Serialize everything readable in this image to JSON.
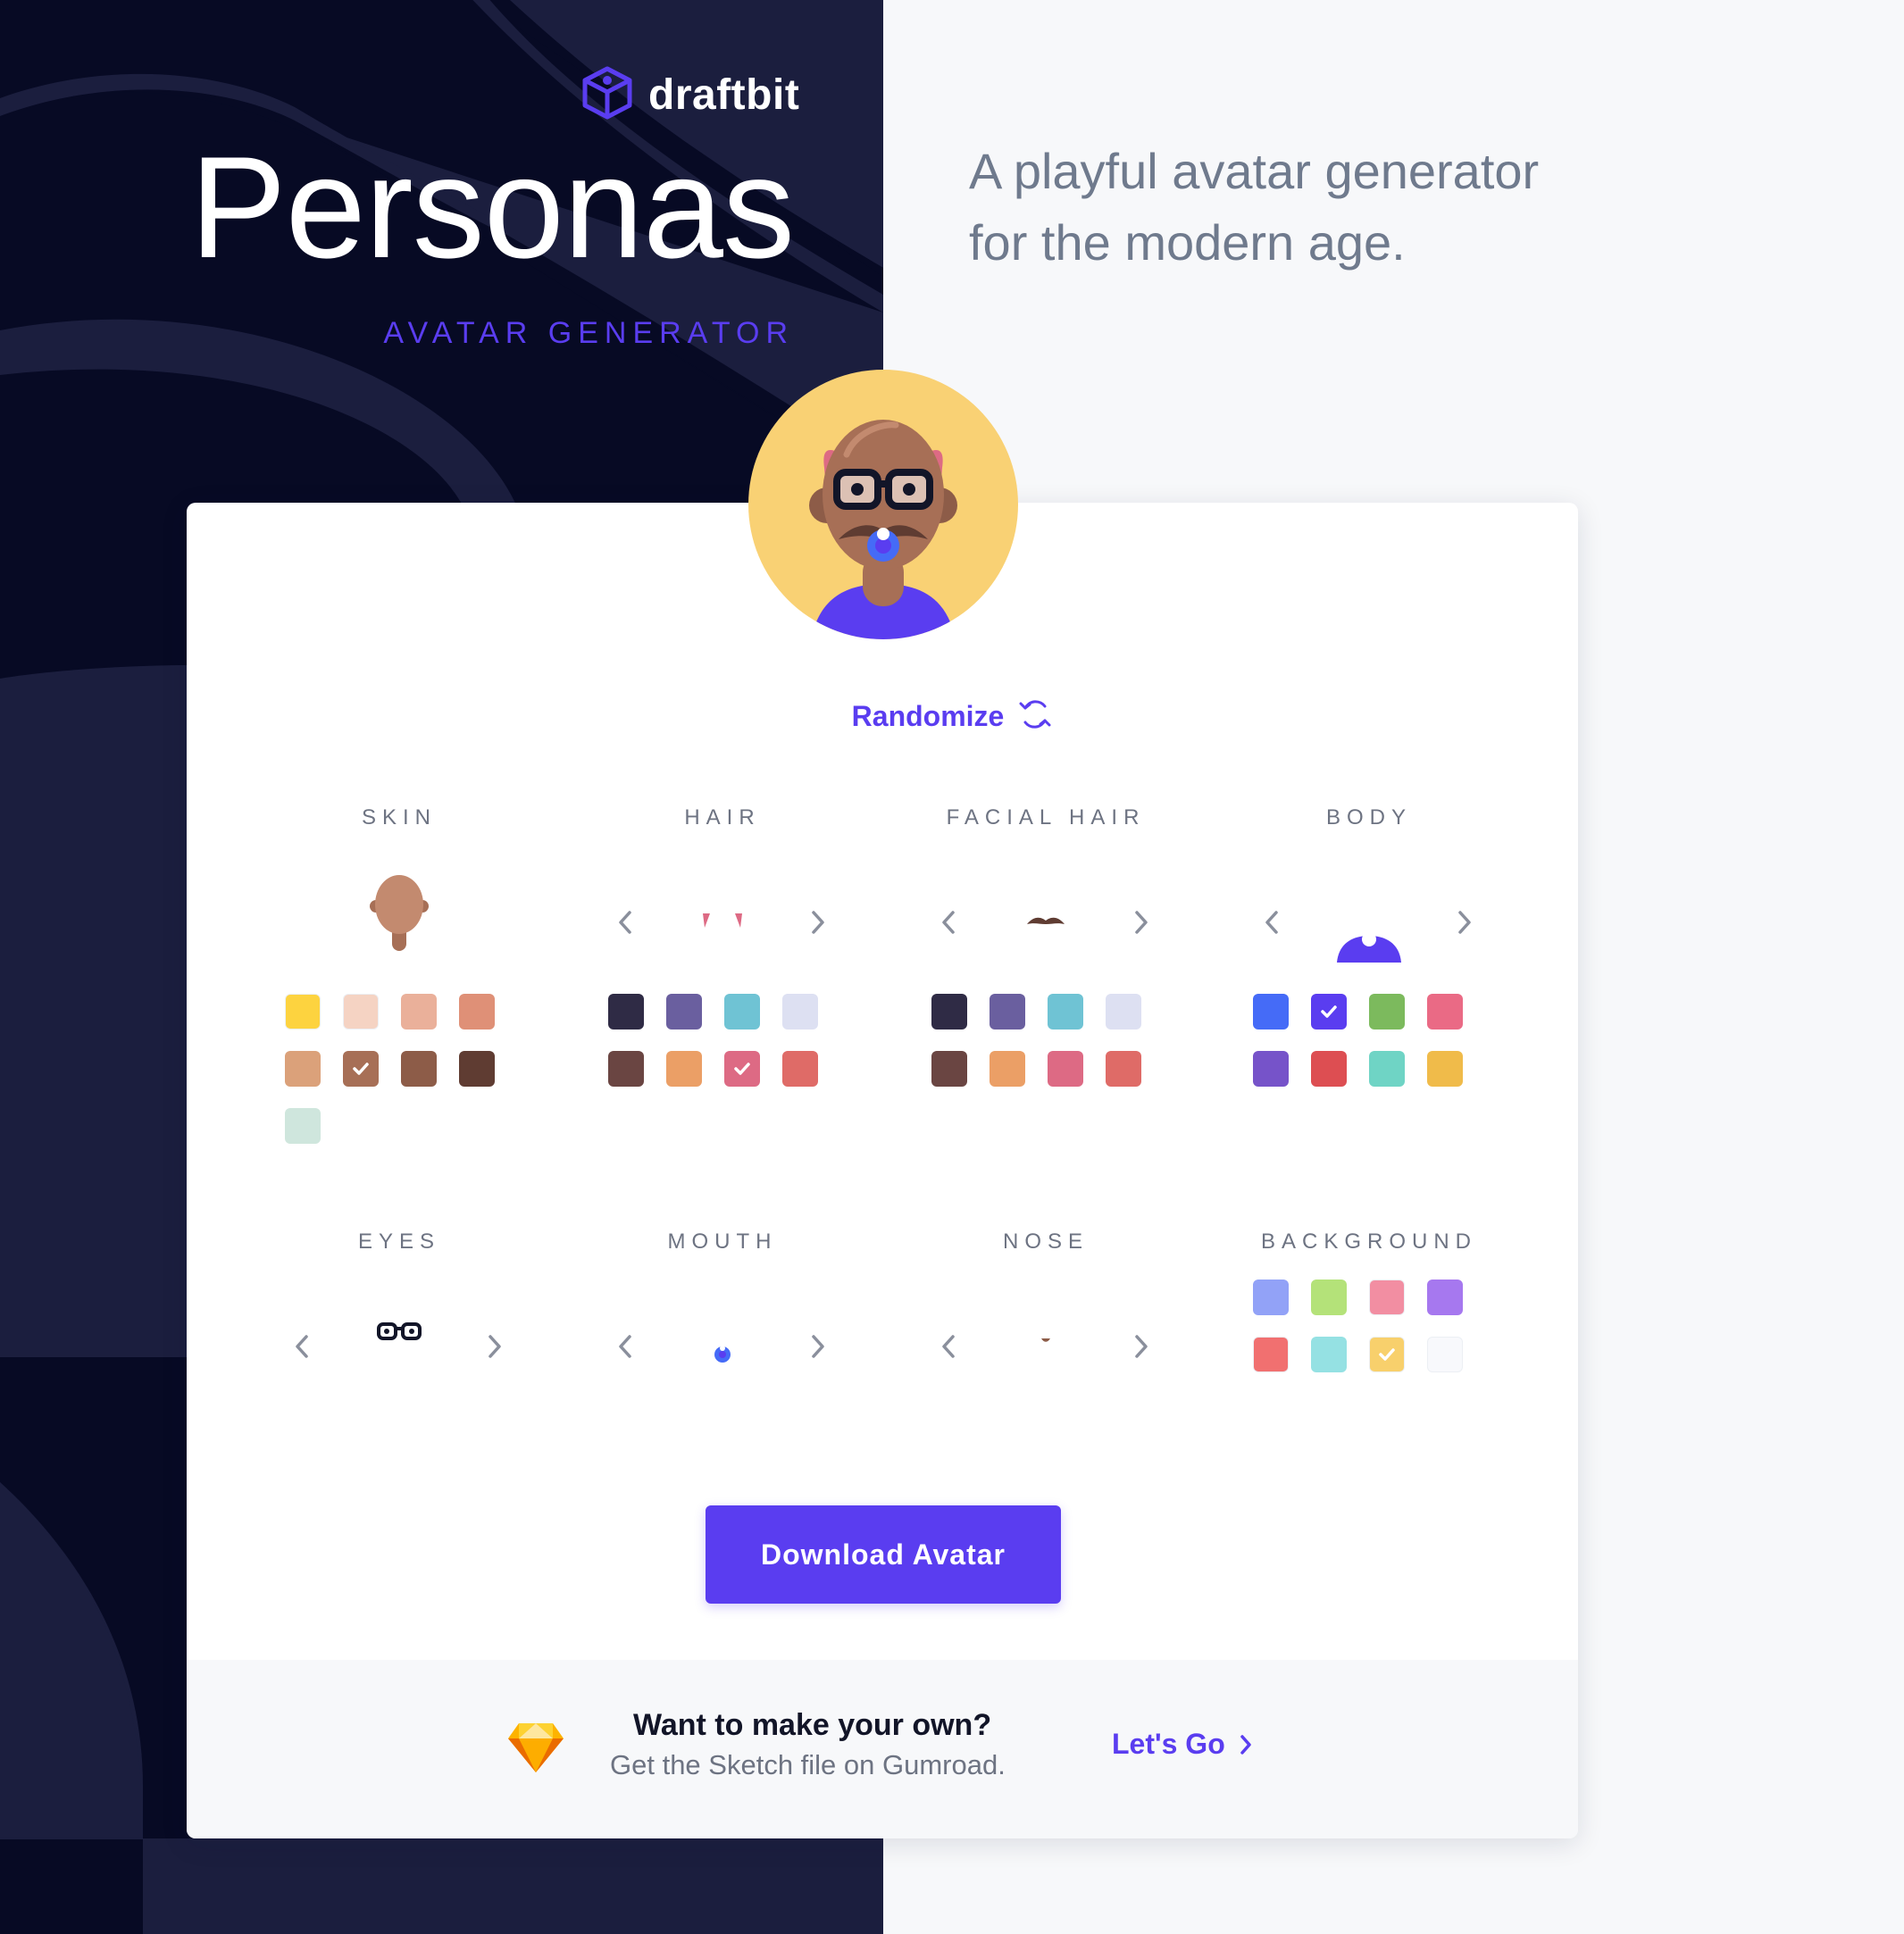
{
  "brand": {
    "name": "draftbit",
    "logo_icon": "cube-icon"
  },
  "hero": {
    "title": "Personas",
    "subtitle": "AVATAR GENERATOR"
  },
  "tagline": {
    "line1": "A playful avatar generator",
    "line2": "for the modern age."
  },
  "randomize": {
    "label": "Randomize",
    "icon": "refresh-icon"
  },
  "sections": {
    "skin": {
      "title": "SKIN",
      "swatches": [
        "#fdd33f",
        "#f5d3c3",
        "#eab09a",
        "#df9077",
        "#dba17a",
        "#a76f56",
        "#8d5c48",
        "#5f3c32",
        "#cfe6dd"
      ],
      "selected_index": 5
    },
    "hair": {
      "title": "HAIR",
      "swatches": [
        "#2f2b45",
        "#6a5f9f",
        "#6fc3d4",
        "#dde0f2",
        "#6a4542",
        "#eb9f66",
        "#dd6a84",
        "#df6b67"
      ],
      "selected_index": 6
    },
    "facial_hair": {
      "title": "FACIAL HAIR",
      "swatches": [
        "#2f2b45",
        "#6a5f9f",
        "#6fc3d4",
        "#dde0f2",
        "#6a4542",
        "#eb9f66",
        "#dd6a84",
        "#df6b67"
      ],
      "selected_index": null
    },
    "body": {
      "title": "BODY",
      "swatches": [
        "#456bf7",
        "#5a3df0",
        "#7cba5d",
        "#ea6a85",
        "#7653c9",
        "#dd4e52",
        "#6fd4c5",
        "#f0bb4a"
      ],
      "selected_index": 1
    },
    "eyes": {
      "title": "EYES"
    },
    "mouth": {
      "title": "MOUTH"
    },
    "nose": {
      "title": "NOSE"
    },
    "background": {
      "title": "BACKGROUND",
      "swatches": [
        "#92a2f7",
        "#b4e279",
        "#f28ea2",
        "#a678ef",
        "#f17070",
        "#95e1e3",
        "#f8d06c",
        "#f8f9fc"
      ],
      "selected_index": 6
    }
  },
  "download": {
    "label": "Download Avatar"
  },
  "cta": {
    "heading": "Want to make your own?",
    "subtext": "Get the Sketch file on Gumroad.",
    "link_label": "Let's Go",
    "icon": "sketch-diamond-icon"
  },
  "colors": {
    "accent": "#5a3df0",
    "dark_bg": "#070a24",
    "light_bg": "#f7f8fa"
  }
}
